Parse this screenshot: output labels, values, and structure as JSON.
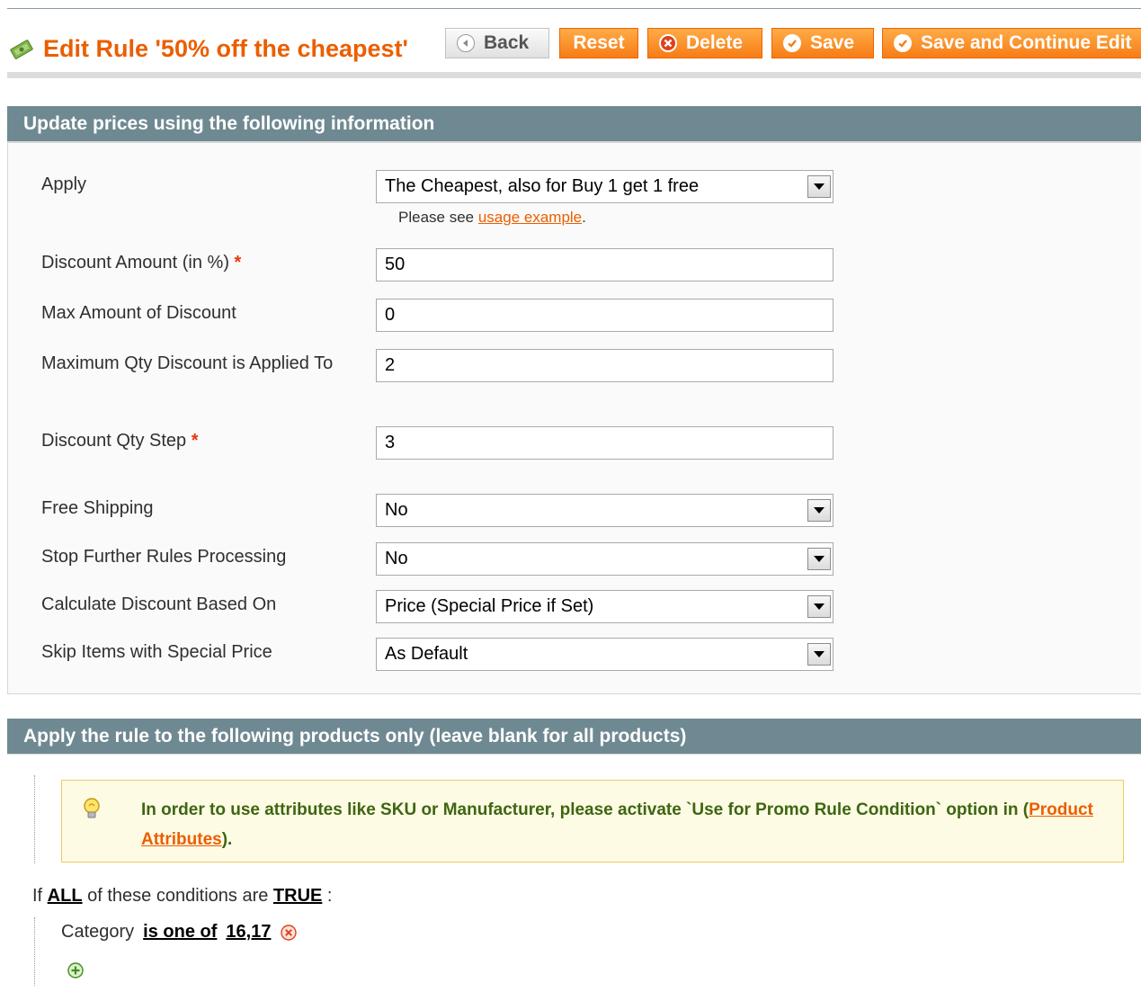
{
  "header": {
    "title": "Edit Rule '50% off the cheapest'",
    "buttons": {
      "back": "Back",
      "reset": "Reset",
      "delete": "Delete",
      "save": "Save",
      "save_continue": "Save and Continue Edit"
    }
  },
  "actions_section": {
    "heading": "Update prices using the following information",
    "apply": {
      "label": "Apply",
      "value": "The Cheapest, also for Buy 1 get 1 free"
    },
    "note": {
      "prefix": "Please see ",
      "link": "usage example",
      "suffix": "."
    },
    "discount_amount": {
      "label": "Discount Amount (in %)",
      "required": "*",
      "value": "50"
    },
    "max_amount": {
      "label": "Max Amount of Discount",
      "value": "0"
    },
    "max_qty": {
      "label": "Maximum Qty Discount is Applied To",
      "value": "2"
    },
    "qty_step": {
      "label": "Discount Qty Step",
      "required": "*",
      "value": "3"
    },
    "free_shipping": {
      "label": "Free Shipping",
      "value": "No"
    },
    "stop_rules": {
      "label": "Stop Further Rules Processing",
      "value": "No"
    },
    "calc_based_on": {
      "label": "Calculate Discount Based On",
      "value": "Price (Special Price if Set)"
    },
    "skip_special": {
      "label": "Skip Items with Special Price",
      "value": "As Default"
    }
  },
  "conditions_section": {
    "heading": "Apply the rule to the following products only (leave blank for all products)",
    "notice": {
      "text": "In order to use attributes like SKU or Manufacturer, please activate `Use for Promo Rule Condition` option in (",
      "link": "Product Attributes",
      "suffix": ")."
    },
    "condition_header": {
      "prefix": "If ",
      "aggregator": "ALL",
      "middle": " of these conditions are ",
      "value": "TRUE",
      "suffix": " :"
    },
    "condition": {
      "attribute": "Category",
      "operator": "is one of",
      "value": "16,17"
    }
  },
  "colors": {
    "accent": "#eb5e00",
    "button_orange": "#f77c16",
    "section_head": "#6f8992",
    "notice_text": "#3d6611"
  },
  "icons": [
    "rule-tag-icon",
    "back-arrow-icon",
    "delete-x-icon",
    "check-icon",
    "lightbulb-icon",
    "remove-condition-icon",
    "add-condition-icon"
  ]
}
